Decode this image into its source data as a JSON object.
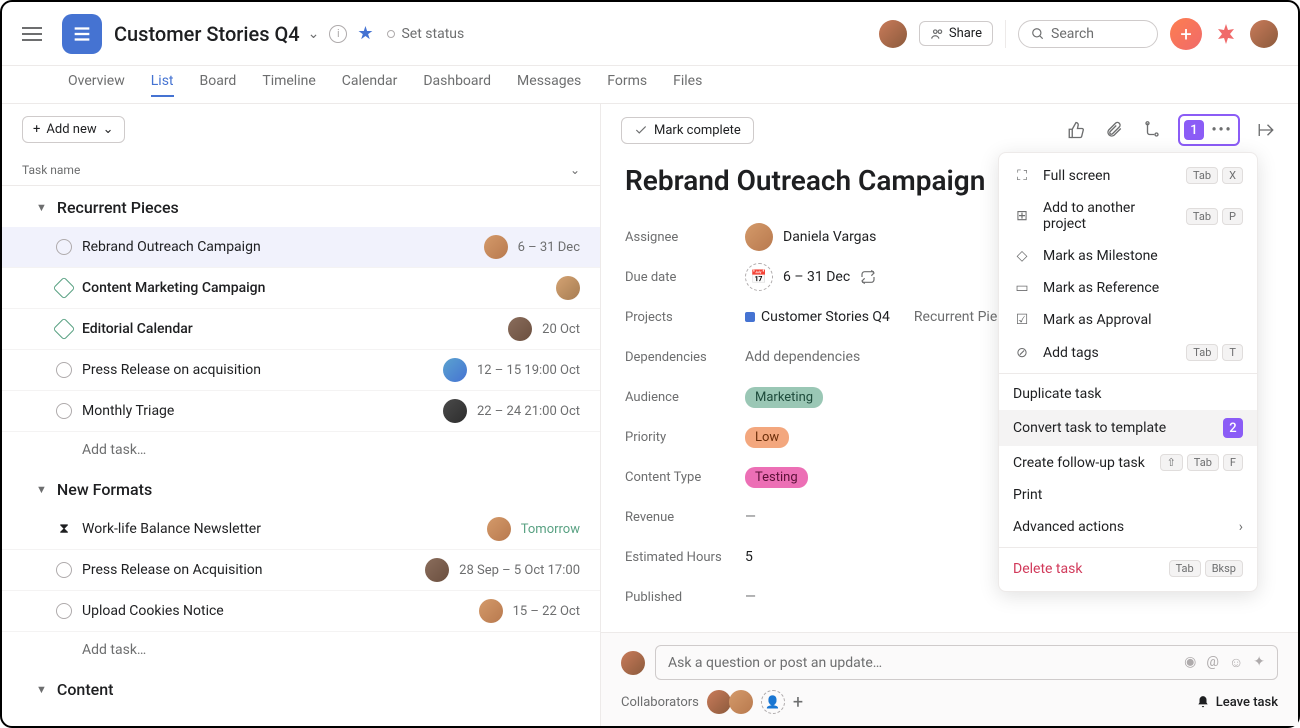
{
  "header": {
    "title": "Customer Stories Q4",
    "set_status": "Set status",
    "share": "Share",
    "search_placeholder": "Search"
  },
  "tabs": [
    "Overview",
    "List",
    "Board",
    "Timeline",
    "Calendar",
    "Dashboard",
    "Messages",
    "Forms",
    "Files"
  ],
  "active_tab": "List",
  "add_new": "Add new",
  "col_header": "Task name",
  "sections": [
    {
      "title": "Recurrent Pieces",
      "tasks": [
        {
          "title": "Rebrand Outreach Campaign",
          "date": "6 – 31 Dec",
          "check": "circle",
          "bold": false,
          "avatar": "a6",
          "selected": true,
          "date_color": ""
        },
        {
          "title": "Content Marketing Campaign",
          "date": "",
          "check": "milestone",
          "bold": true,
          "avatar": "a2",
          "selected": false,
          "date_color": ""
        },
        {
          "title": "Editorial Calendar",
          "date": "20 Oct",
          "check": "milestone",
          "bold": true,
          "avatar": "a5",
          "selected": false,
          "date_color": ""
        },
        {
          "title": "Press Release on acquisition",
          "date": "12 – 15 19:00 Oct",
          "check": "circle",
          "bold": false,
          "avatar": "a3",
          "selected": false,
          "date_color": ""
        },
        {
          "title": "Monthly Triage",
          "date": "22 – 24 21:00 Oct",
          "check": "circle",
          "bold": false,
          "avatar": "a4",
          "selected": false,
          "date_color": ""
        }
      ],
      "add_task": "Add task…"
    },
    {
      "title": "New Formats",
      "tasks": [
        {
          "title": "Work-life Balance Newsletter",
          "date": "Tomorrow",
          "check": "hourglass",
          "bold": false,
          "avatar": "a6",
          "selected": false,
          "date_color": "green"
        },
        {
          "title": "Press Release on Acquisition",
          "date": "28 Sep – 5 Oct 17:00",
          "check": "circle",
          "bold": false,
          "avatar": "a5",
          "selected": false,
          "date_color": ""
        },
        {
          "title": "Upload Cookies Notice",
          "date": "15 – 22 Oct",
          "check": "circle",
          "bold": false,
          "avatar": "a6",
          "selected": false,
          "date_color": ""
        }
      ],
      "add_task": "Add task…"
    },
    {
      "title": "Content",
      "tasks": [],
      "add_task": ""
    }
  ],
  "detail": {
    "mark_complete": "Mark complete",
    "title": "Rebrand Outreach Campaign",
    "badge_num": "1",
    "fields": {
      "assignee_label": "Assignee",
      "assignee_name": "Daniela Vargas",
      "due_label": "Due date",
      "due_value": "6 – 31 Dec",
      "projects_label": "Projects",
      "project_name": "Customer Stories Q4",
      "project2": "Recurrent Pie",
      "deps_label": "Dependencies",
      "deps_value": "Add dependencies",
      "audience_label": "Audience",
      "audience_tag": "Marketing",
      "priority_label": "Priority",
      "priority_tag": "Low",
      "content_label": "Content Type",
      "content_tag": "Testing",
      "revenue_label": "Revenue",
      "revenue_value": "—",
      "hours_label": "Estimated Hours",
      "hours_value": "5",
      "published_label": "Published",
      "published_value": "—"
    }
  },
  "menu": {
    "items1": [
      {
        "icon": "⛶",
        "label": "Full screen",
        "kbd": [
          "Tab",
          "X"
        ]
      },
      {
        "icon": "⊞",
        "label": "Add to another project",
        "kbd": [
          "Tab",
          "P"
        ]
      },
      {
        "icon": "◇",
        "label": "Mark as Milestone",
        "kbd": []
      },
      {
        "icon": "▭",
        "label": "Mark as Reference",
        "kbd": []
      },
      {
        "icon": "☑",
        "label": "Mark as Approval",
        "kbd": []
      },
      {
        "icon": "⊘",
        "label": "Add tags",
        "kbd": [
          "Tab",
          "T"
        ]
      }
    ],
    "items2": [
      {
        "label": "Duplicate task",
        "kbd": [],
        "badge": ""
      },
      {
        "label": "Convert task to template",
        "kbd": [],
        "badge": "2",
        "hover": true
      },
      {
        "label": "Create follow-up task",
        "kbd": [
          "⇧",
          "Tab",
          "F"
        ],
        "badge": ""
      },
      {
        "label": "Print",
        "kbd": [],
        "badge": ""
      }
    ],
    "advanced": "Advanced actions",
    "delete": "Delete task",
    "delete_kbd": [
      "Tab",
      "Bksp"
    ]
  },
  "comment": {
    "placeholder": "Ask a question or post an update…",
    "collaborators": "Collaborators",
    "leave": "Leave task"
  }
}
